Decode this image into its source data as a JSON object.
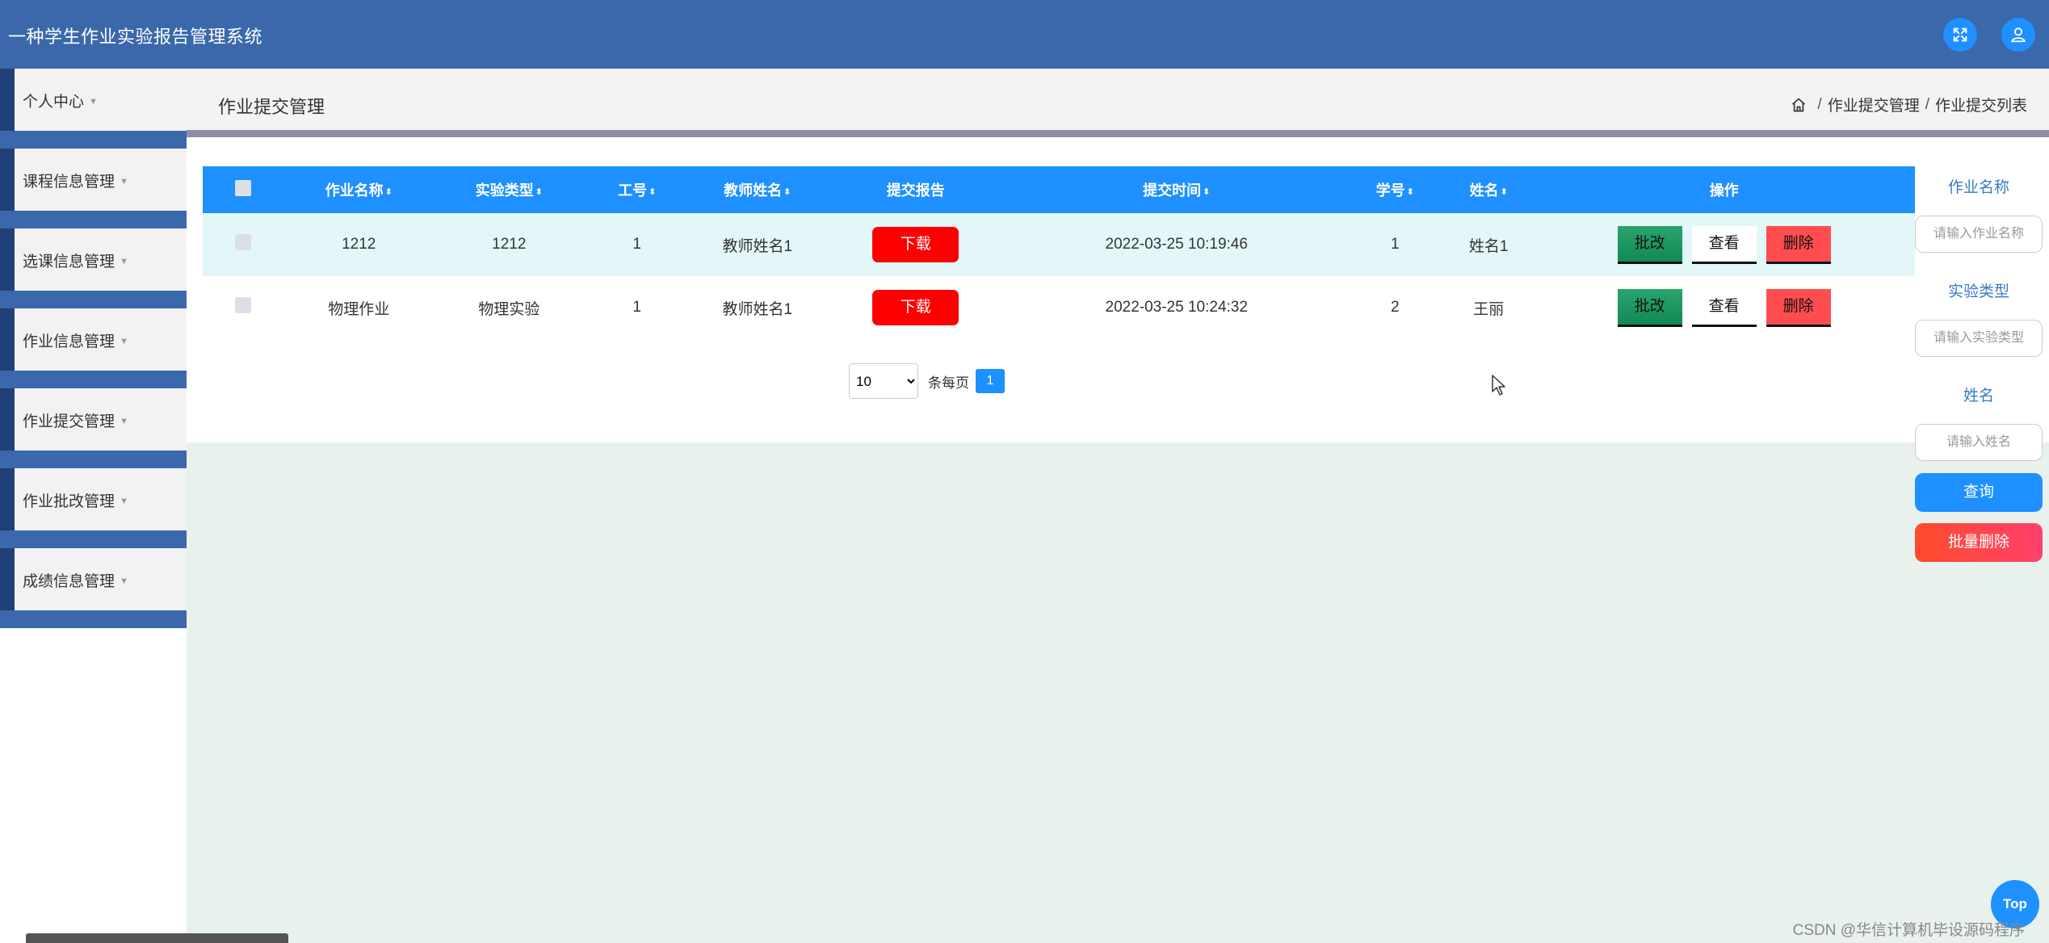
{
  "app": {
    "title": "一种学生作业实验报告管理系统"
  },
  "header": {
    "fullscreen_icon": "fullscreen-icon",
    "user_icon": "user-icon"
  },
  "sidebar": {
    "items": [
      {
        "label": "个人中心"
      },
      {
        "label": "课程信息管理"
      },
      {
        "label": "选课信息管理"
      },
      {
        "label": "作业信息管理"
      },
      {
        "label": "作业提交管理"
      },
      {
        "label": "作业批改管理"
      },
      {
        "label": "成绩信息管理"
      }
    ]
  },
  "page": {
    "title": "作业提交管理",
    "breadcrumb": [
      "作业提交管理",
      "作业提交列表"
    ]
  },
  "table": {
    "columns": [
      "作业名称",
      "实验类型",
      "工号",
      "教师姓名",
      "提交报告",
      "提交时间",
      "学号",
      "姓名",
      "操作"
    ],
    "sortable": [
      true,
      true,
      true,
      true,
      false,
      true,
      true,
      true,
      false
    ],
    "rows": [
      {
        "name": "1212",
        "type": "1212",
        "job_no": "1",
        "teacher": "教师姓名1",
        "report": "下载",
        "time": "2022-03-25 10:19:46",
        "student_no": "1",
        "student_name": "姓名1"
      },
      {
        "name": "物理作业",
        "type": "物理实验",
        "job_no": "1",
        "teacher": "教师姓名1",
        "report": "下载",
        "time": "2022-03-25 10:24:32",
        "student_no": "2",
        "student_name": "王丽"
      }
    ],
    "actions": {
      "review": "批改",
      "view": "查看",
      "delete": "删除"
    }
  },
  "pager": {
    "page_size": "10",
    "page_size_options": [
      "10"
    ],
    "per_page_label": "条每页",
    "current_page": "1"
  },
  "search": {
    "fields": [
      {
        "label": "作业名称",
        "placeholder": "请输入作业名称"
      },
      {
        "label": "实验类型",
        "placeholder": "请输入实验类型"
      },
      {
        "label": "姓名",
        "placeholder": "请输入姓名"
      }
    ],
    "query_label": "查询",
    "batch_delete_label": "批量删除"
  },
  "misc": {
    "top_label": "Top",
    "watermark": "CSDN @华信计算机毕设源码程序"
  },
  "colors": {
    "header": "#3a68ab",
    "primary": "#1e90ff",
    "download": "#ff0000",
    "review": "#138a55",
    "delete": "#ff4d4f"
  }
}
